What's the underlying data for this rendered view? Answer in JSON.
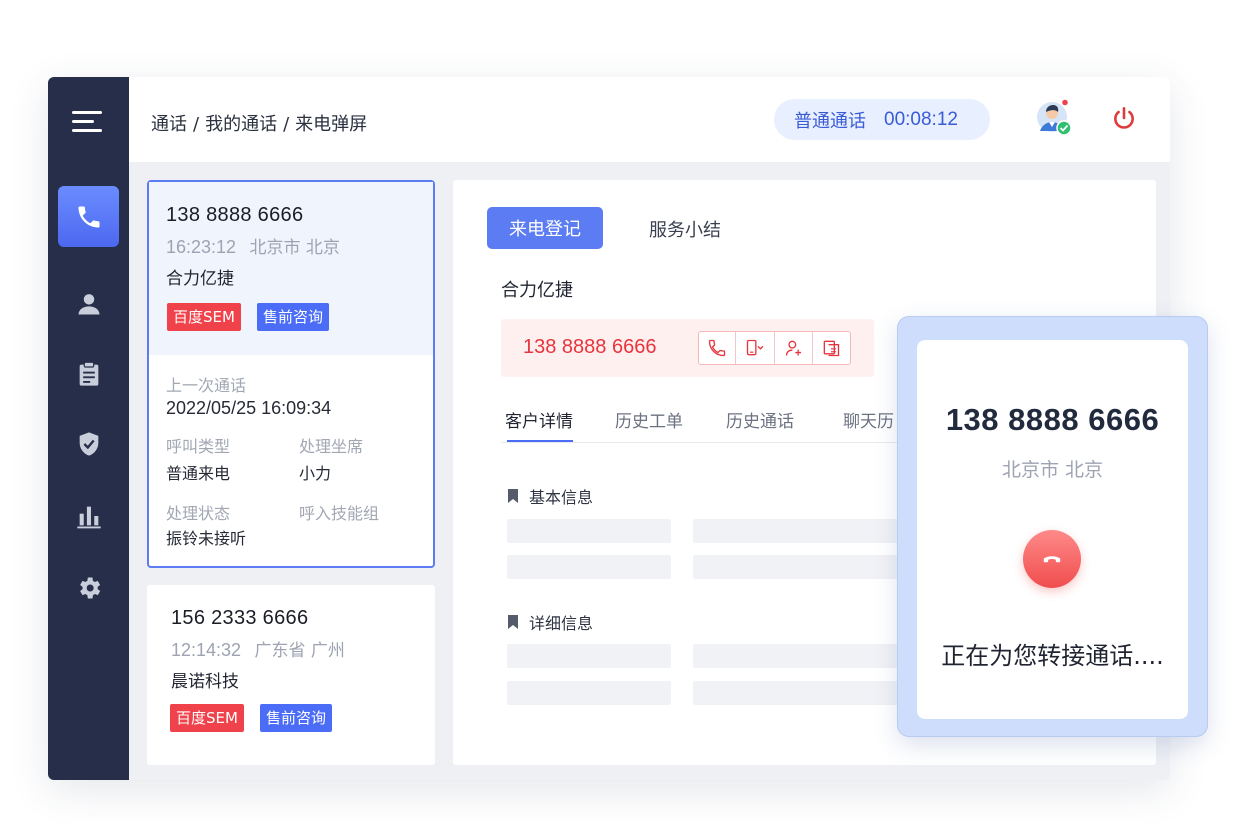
{
  "header": {
    "breadcrumb": [
      "通话",
      "我的通话",
      "来电弹屏"
    ],
    "call_type": "普通通话",
    "call_timer": "00:08:12"
  },
  "sidebar": {
    "items": [
      {
        "icon": "phone-icon",
        "active": true
      },
      {
        "icon": "user-icon",
        "active": false
      },
      {
        "icon": "clipboard-icon",
        "active": false
      },
      {
        "icon": "shield-icon",
        "active": false
      },
      {
        "icon": "bar-chart-icon",
        "active": false
      },
      {
        "icon": "gear-icon",
        "active": false
      }
    ]
  },
  "calls": [
    {
      "number": "138 8888 6666",
      "time": "16:23:12",
      "location": "北京市 北京",
      "company": "合力亿捷",
      "tags": [
        "百度SEM",
        "售前咨询"
      ],
      "last_call_label": "上一次通话",
      "last_call_value": "2022/05/25  16:09:34",
      "call_kind_label": "呼叫类型",
      "call_kind_value": "普通来电",
      "agent_label": "处理坐席",
      "agent_value": "小力",
      "state_label": "处理状态",
      "state_value": "振铃未接听",
      "skill_group_label": "呼入技能组"
    },
    {
      "number": "156 2333 6666",
      "time": "12:14:32",
      "location": "广东省 广州",
      "company": "晨诺科技",
      "tags": [
        "百度SEM",
        "售前咨询"
      ]
    }
  ],
  "main": {
    "tabs": [
      "来电登记",
      "服务小结"
    ],
    "customer_name": "合力亿捷",
    "phone": "138 8888 6666",
    "subtabs": [
      "客户详情",
      "历史工单",
      "历史通话",
      "聊天历"
    ],
    "section_basic": "基本信息",
    "section_detail": "详细信息"
  },
  "popup": {
    "number": "138 8888 6666",
    "location": "北京市 北京",
    "status": "正在为您转接通话...."
  },
  "colors": {
    "sidebar": "#262e4a",
    "accent": "#5b7cf2",
    "danger": "#f0424a"
  }
}
